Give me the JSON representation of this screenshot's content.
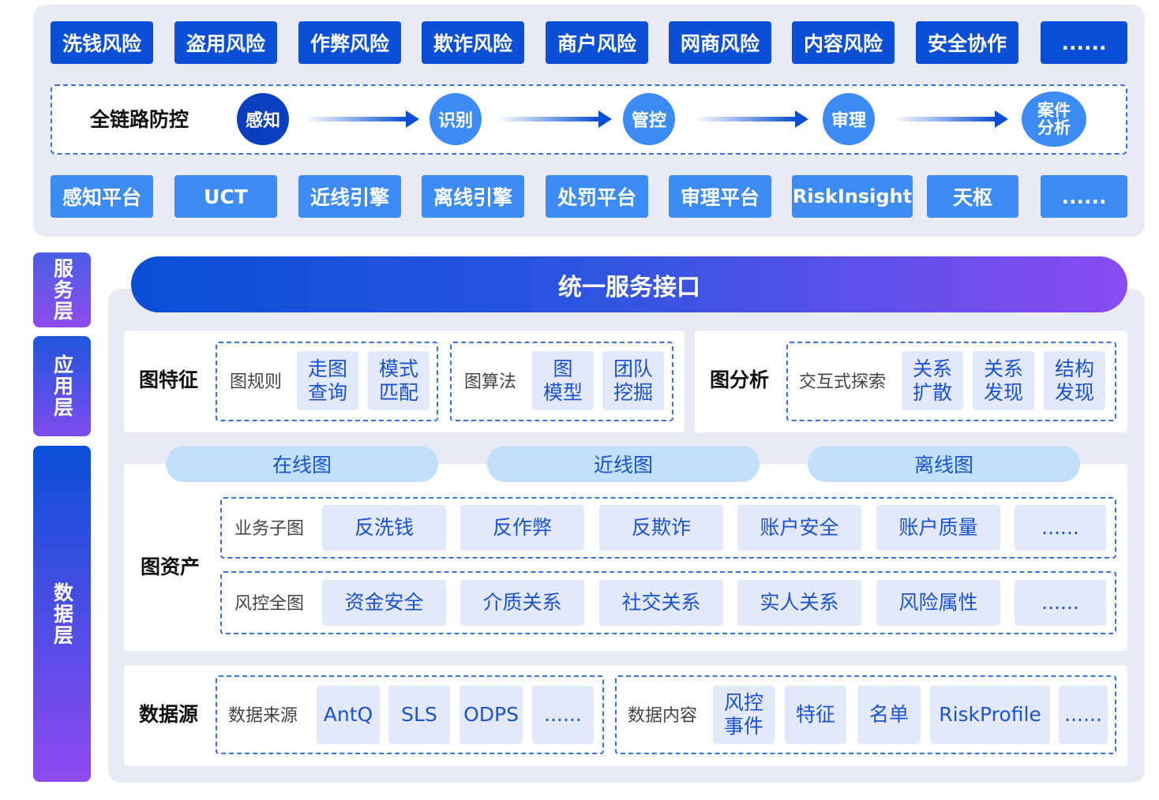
{
  "risks": [
    "洗钱风险",
    "盗用风险",
    "作弊风险",
    "欺诈风险",
    "商户风险",
    "网商风险",
    "内容风险",
    "安全协作",
    "......"
  ],
  "chain": {
    "title": "全链路防控",
    "steps": [
      "感知",
      "识别",
      "管控",
      "审理",
      "案件\n分析"
    ]
  },
  "platforms": [
    "感知平台",
    "UCT",
    "近线引擎",
    "离线引擎",
    "处罚平台",
    "审理平台",
    "RiskInsight",
    "天枢",
    "......"
  ],
  "layers": {
    "service": "服务层",
    "application": "应用层",
    "data": "数据层"
  },
  "service_bar": "统一服务接口",
  "graph_feature": {
    "title": "图特征",
    "rule_label": "图规则",
    "rule_items": [
      "走图\n查询",
      "模式\n匹配"
    ],
    "algo_label": "图算法",
    "algo_items": [
      "图\n模型",
      "团队\n挖掘"
    ]
  },
  "graph_analysis": {
    "title": "图分析",
    "label": "交互式探索",
    "items": [
      "关系\n扩散",
      "关系\n发现",
      "结构\n发现"
    ]
  },
  "graph_types": [
    "在线图",
    "近线图",
    "离线图"
  ],
  "graph_assets": {
    "title": "图资产",
    "business_label": "业务子图",
    "business_items": [
      "反洗钱",
      "反作弊",
      "反欺诈",
      "账户安全",
      "账户质量",
      "......"
    ],
    "risk_label": "风控全图",
    "risk_items": [
      "资金安全",
      "介质关系",
      "社交关系",
      "实人关系",
      "风险属性",
      "......"
    ]
  },
  "data_source": {
    "title": "数据源",
    "source_label": "数据来源",
    "source_items": [
      "AntQ",
      "SLS",
      "ODPS",
      "......"
    ],
    "content_label": "数据内容",
    "content_items": [
      "风控\n事件",
      "特征",
      "名单",
      "RiskProfile",
      "......"
    ]
  },
  "colors": {
    "primary": "#0a4fd6",
    "secondary": "#3d8cf5",
    "chip_bg": "#e3e9fa",
    "chip_text": "#1a52d4",
    "panel_bg": "#e8ebf5",
    "accent_purple": "#8b4cf0"
  }
}
